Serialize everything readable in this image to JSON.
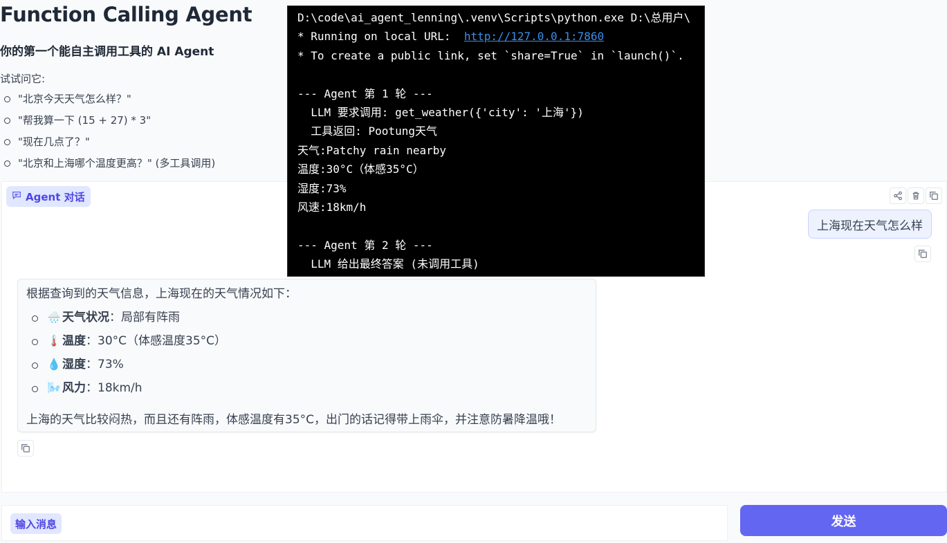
{
  "header": {
    "title": "Function Calling Agent",
    "subtitle": "你的第一个能自主调用工具的 AI Agent",
    "try_label": "试试问它:",
    "examples": [
      "\"北京今天天气怎么样？\"",
      "\"帮我算一下 (15 + 27) * 3\"",
      "\"现在几点了？\"",
      "\"北京和上海哪个温度更高？\" (多工具调用)"
    ]
  },
  "chat": {
    "label": "Agent 对话",
    "icons": [
      "chat-icon",
      "share-icon",
      "trash-icon",
      "copy-icon"
    ],
    "user_message": "上海现在天气怎么样",
    "bot": {
      "intro": "根据查询到的天气信息，上海现在的天气情况如下：",
      "items": [
        {
          "emoji": "🌧️",
          "key": "天气状况",
          "value": "：局部有阵雨"
        },
        {
          "emoji": "🌡️",
          "key": "温度",
          "value": "：30°C（体感温度35°C）"
        },
        {
          "emoji": "💧",
          "key": "湿度",
          "value": "：73%"
        },
        {
          "emoji": "🌬️",
          "key": "风力",
          "value": "：18km/h"
        }
      ],
      "outro": "上海的天气比较闷热，而且还有阵雨，体感温度有35°C，出门的话记得带上雨伞，并注意防暑降温哦！"
    }
  },
  "terminal": {
    "lines": [
      "D:\\code\\ai_agent_lenning\\.venv\\Scripts\\python.exe D:\\总用户\\",
      "* Running on local URL:  ",
      "* To create a public link, set `share=True` in `launch()`.",
      "",
      "--- Agent 第 1 轮 ---",
      "  LLM 要求调用: get_weather({'city': '上海'})",
      "  工具返回: Pootung天气",
      "天气:Patchy rain nearby",
      "温度:30°C（体感35°C）",
      "湿度:73%",
      "风速:18km/h",
      "",
      "--- Agent 第 2 轮 ---",
      "  LLM 给出最终答案 (未调用工具)"
    ],
    "url": "http://127.0.0.1:7860",
    "link_color": "#3b8eea"
  },
  "input": {
    "label": "输入消息",
    "value": "",
    "send_label": "发送"
  },
  "colors": {
    "accent": "#6366f1",
    "label_bg": "#e0e7ff",
    "label_text": "#4f46e5"
  }
}
